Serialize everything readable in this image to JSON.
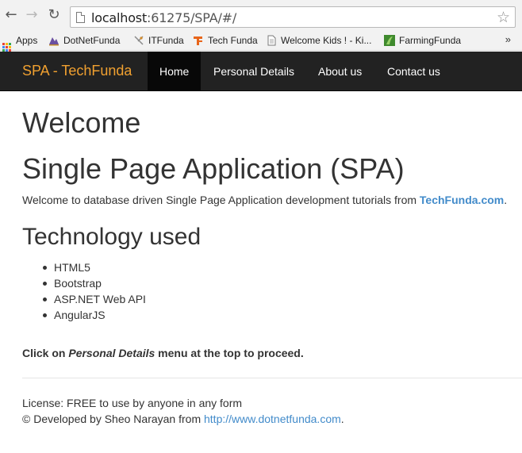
{
  "browser": {
    "back_icon": "back-arrow-icon",
    "forward_icon": "forward-arrow-icon",
    "reload_icon": "reload-icon",
    "url_host": "localhost",
    "url_rest": ":61275/SPA/#/",
    "bookmark_star_icon": "star-icon",
    "bookmarks": [
      {
        "label": "Apps",
        "icon": "apps-grid-icon"
      },
      {
        "label": "DotNetFunda",
        "icon": "dotnetfunda-icon"
      },
      {
        "label": "ITFunda",
        "icon": "itfunda-icon"
      },
      {
        "label": "Tech Funda",
        "icon": "techfunda-icon"
      },
      {
        "label": "Welcome Kids ! - Ki...",
        "icon": "page-icon"
      },
      {
        "label": "FarmingFunda",
        "icon": "farmingfunda-icon"
      }
    ],
    "bookmarks_more": "»"
  },
  "navbar": {
    "brand": "SPA - TechFunda",
    "items": [
      {
        "label": "Home",
        "active": true
      },
      {
        "label": "Personal Details",
        "active": false
      },
      {
        "label": "About us",
        "active": false
      },
      {
        "label": "Contact us",
        "active": false
      }
    ]
  },
  "content": {
    "welcome": "Welcome",
    "title": "Single Page Application (SPA)",
    "lead_prefix": "Welcome to database driven Single Page Application development tutorials from ",
    "lead_link": "TechFunda.com",
    "lead_suffix": ".",
    "tech_heading": "Technology used",
    "technologies": [
      "HTML5",
      "Bootstrap",
      "ASP.NET Web API",
      "AngularJS"
    ],
    "instruction_prefix": "Click on ",
    "instruction_em": "Personal Details",
    "instruction_suffix": " menu at the top to proceed."
  },
  "footer": {
    "license": "License: FREE to use by anyone in any form",
    "developed_prefix": "© Developed by Sheo Narayan from ",
    "developed_link": "http://www.dotnetfunda.com",
    "developed_suffix": "."
  },
  "colors": {
    "brand": "#f0a030",
    "navbar_bg": "#222222",
    "link": "#428bca"
  }
}
